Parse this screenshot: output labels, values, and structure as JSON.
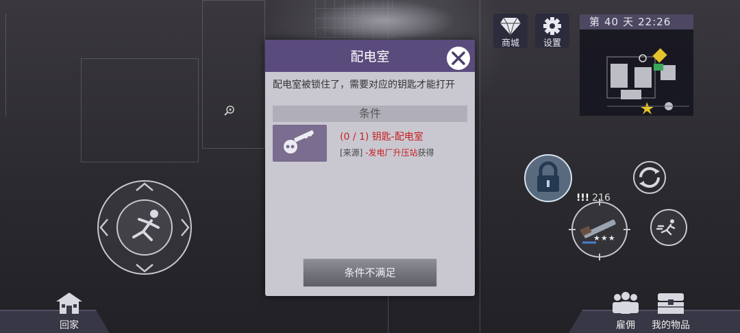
{
  "header": {
    "shop_label": "商城",
    "settings_label": "设置"
  },
  "minimap": {
    "day_prefix": "第",
    "day_number": "40",
    "day_suffix": "天",
    "time": "22:26"
  },
  "dialog": {
    "title": "配电室",
    "description": "配电室被锁住了，需要对应的钥匙才能打开",
    "conditions_title": "条件",
    "requirement": "(0 / 1) 钥匙-配电室",
    "source_prefix": "[来源]",
    "source_name": "-发电厂升压站",
    "source_suffix": "获得",
    "confirm_button": "条件不满足"
  },
  "weapon": {
    "alert": "!!!",
    "ammo": "216",
    "stars": "★★★"
  },
  "bottom": {
    "home_label": "回家",
    "hire_label": "雇佣",
    "items_label": "我的物品"
  },
  "icons": [
    "diamond-icon",
    "gear-icon",
    "close-icon",
    "key-icon",
    "run-icon",
    "lock-icon",
    "refresh-icon",
    "rifle-icon",
    "sprint-icon",
    "house-icon",
    "people-icon",
    "chest-icon",
    "zoom-icon"
  ],
  "colors": {
    "dialog_header": "#5a4b7d",
    "dialog_body": "#c9c8d1",
    "requirement_red": "#c81e1e"
  }
}
